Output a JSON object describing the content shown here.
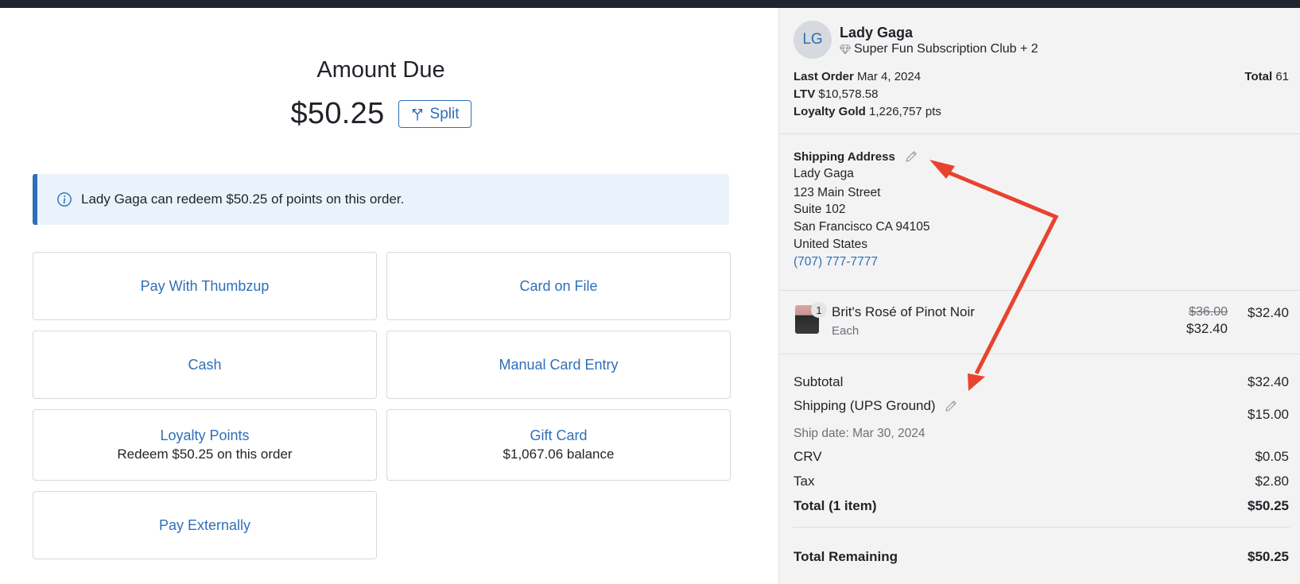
{
  "payment": {
    "title": "Amount Due",
    "amount": "$50.25",
    "split_label": "Split",
    "notice": "Lady Gaga can redeem $50.25 of points on this order.",
    "methods": [
      {
        "label": "Pay With Thumbzup",
        "sub": ""
      },
      {
        "label": "Card on File",
        "sub": ""
      },
      {
        "label": "Cash",
        "sub": ""
      },
      {
        "label": "Manual Card Entry",
        "sub": ""
      },
      {
        "label": "Loyalty Points",
        "sub": "Redeem $50.25 on this order"
      },
      {
        "label": "Gift Card",
        "sub": "$1,067.06 balance"
      },
      {
        "label": "Pay Externally",
        "sub": ""
      }
    ]
  },
  "customer": {
    "initials": "LG",
    "name": "Lady Gaga",
    "club": "Super Fun Subscription Club + 2",
    "last_order_label": "Last Order",
    "last_order_value": "Mar 4, 2024",
    "ltv_label": "LTV",
    "ltv_value": "$10,578.58",
    "loyalty_label": "Loyalty Gold",
    "loyalty_value": "1,226,757 pts",
    "total_label": "Total",
    "total_value": "61"
  },
  "shipping_address": {
    "heading": "Shipping Address",
    "name": "Lady Gaga",
    "street": "123 Main Street",
    "suite": "Suite 102",
    "city_line": "San Francisco CA 94105",
    "country": "United States",
    "phone": "(707) 777-7777"
  },
  "line_item": {
    "quantity": "1",
    "name": "Brit's Rosé of Pinot Noir",
    "unit": "Each",
    "original_price": "$36.00",
    "sale_price": "$32.40",
    "line_total": "$32.40"
  },
  "summary": {
    "subtotal_label": "Subtotal",
    "subtotal_value": "$32.40",
    "shipping_label": "Shipping (UPS Ground)",
    "shipping_value": "$15.00",
    "ship_date": "Ship date: Mar 30, 2024",
    "crv_label": "CRV",
    "crv_value": "$0.05",
    "tax_label": "Tax",
    "tax_value": "$2.80",
    "total_label": "Total (1 item)",
    "total_value": "$50.25",
    "remaining_label": "Total Remaining",
    "remaining_value": "$50.25"
  },
  "colors": {
    "accent": "#2f6fb7",
    "annotation": "#e8432e",
    "topbar": "#1f2630",
    "panel": "#f3f3f3"
  }
}
